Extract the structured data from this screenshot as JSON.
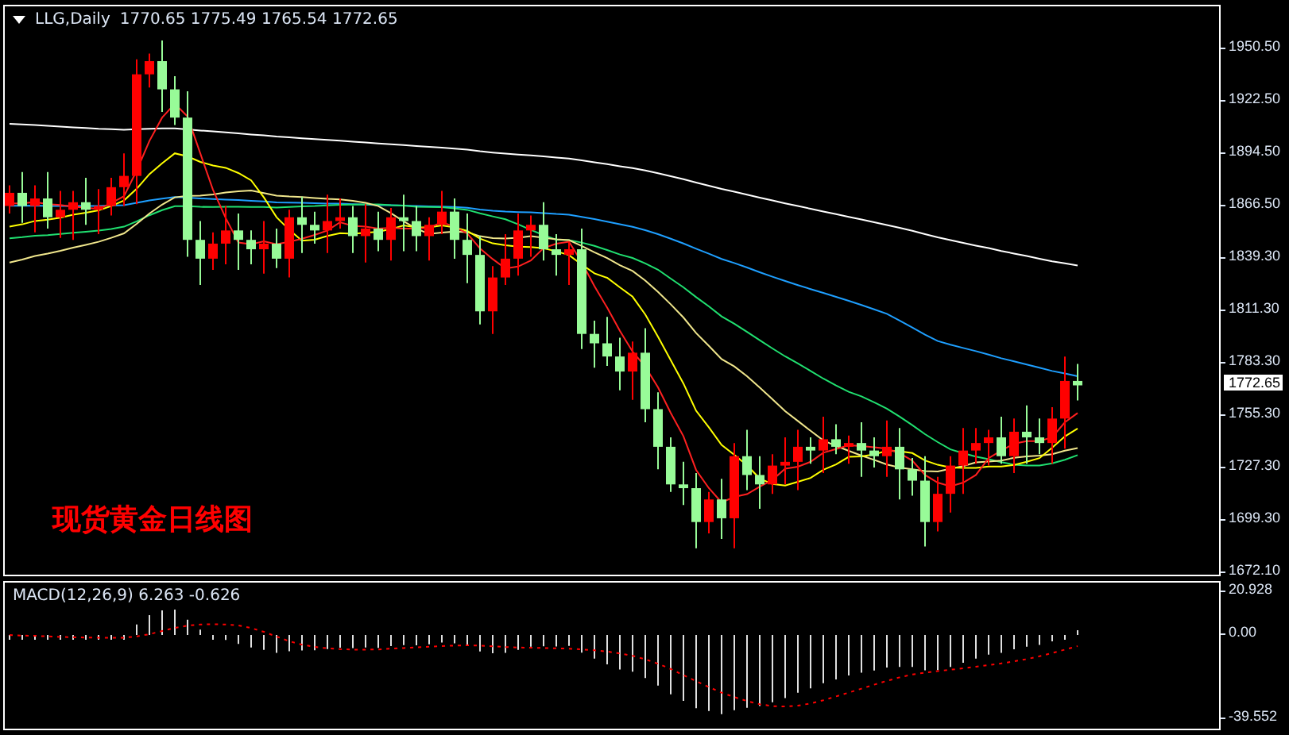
{
  "chart": {
    "symbol": "LLG,Daily",
    "ohlc": "1770.65 1775.49 1765.54 1772.65",
    "caption": "现货黄金日线图",
    "price_ticks": [
      "1950.50",
      "1922.50",
      "1894.50",
      "1866.50",
      "1839.30",
      "1811.30",
      "1783.30",
      "1755.30",
      "1727.30",
      "1699.30",
      "1672.10"
    ],
    "current_price": "1772.65"
  },
  "indicator": {
    "label": "MACD(12,26,9) 6.263 -0.626",
    "ticks": [
      "20.928",
      "0.00",
      "-39.552"
    ]
  }
}
